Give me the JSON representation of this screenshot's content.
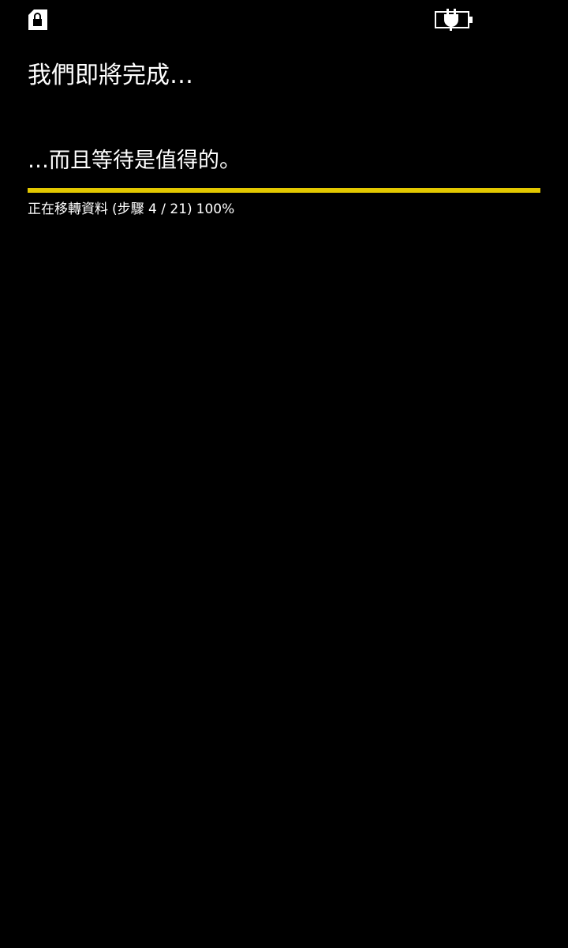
{
  "status_bar": {
    "left_icon": "sim-lock-icon",
    "right_icon": "battery-charging-icon"
  },
  "page": {
    "title": "我們即將完成…",
    "subtitle": "…而且等待是值得的。"
  },
  "progress": {
    "percent": 100,
    "status_text": "正在移轉資料",
    "step_text": "(步驟 4 / 21)",
    "percent_text": "100%",
    "bar_color": "#e3c800"
  }
}
